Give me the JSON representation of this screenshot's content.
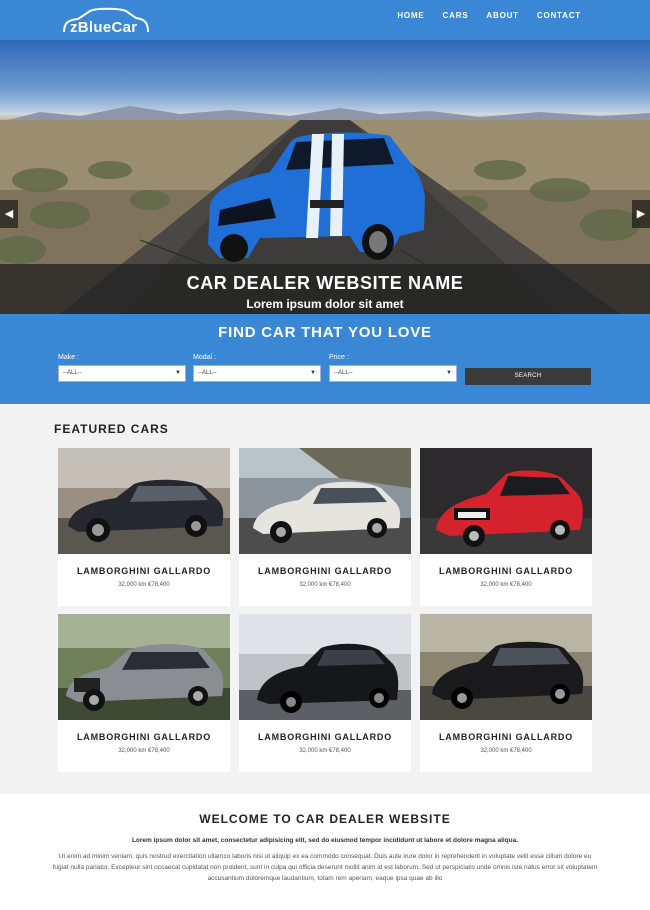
{
  "brand": {
    "name": "zBlueCar"
  },
  "nav": {
    "items": [
      "HOME",
      "CARS",
      "ABOUT",
      "CONTACT"
    ]
  },
  "hero": {
    "title": "CAR DEALER WEBSITE NAME",
    "subtitle": "Lorem ipsum dolor sit amet",
    "prev_icon": "chevron-left-icon",
    "next_icon": "chevron-right-icon"
  },
  "search": {
    "title": "FIND CAR THAT YOU LOVE",
    "fields": [
      {
        "label": "Make :",
        "value": "--ALL--"
      },
      {
        "label": "Modal :",
        "value": "--ALL--"
      },
      {
        "label": "Price :",
        "value": "--ALL--"
      }
    ],
    "button": "SEARCH"
  },
  "featured": {
    "title": "FEATURED CARS",
    "cars": [
      {
        "name": "LAMBORGHINI GALLARDO",
        "meta": "32,000 km €78,400"
      },
      {
        "name": "LAMBORGHINI GALLARDO",
        "meta": "32,000 km €78,400"
      },
      {
        "name": "LAMBORGHINI GALLARDO",
        "meta": "32,000 km €78,400"
      },
      {
        "name": "LAMBORGHINI GALLARDO",
        "meta": "32,000 km €78,400"
      },
      {
        "name": "LAMBORGHINI GALLARDO",
        "meta": "32,000 km €78,400"
      },
      {
        "name": "LAMBORGHINI GALLARDO",
        "meta": "32,000 km €78,400"
      }
    ]
  },
  "welcome": {
    "title": "WELCOME TO CAR DEALER WEBSITE",
    "lead": "Lorem ipsum dolor sit amet, consectetur adipisicing elit, sed do eiusmod tempor incididunt ut labore et dolore magna aliqua.",
    "body": "Ut enim ad minim veniam, quis nostrud exercitation ullamco laboris nisi ut aliquip ex ea commodo consequat. Duis aute irure dolor in reprehenderit in voluptate velit esse cillum dolore eu fugiat nulla pariatur. Excepteur sint occaecat cupidatat non proident, sunt in culpa qui officia deserunt mollit anim id est laborum. Sed ut perspiciatis unde omnis iste natus error sit voluptatem accusantium doloremque laudantium, totam rem aperiam, eaque ipsa quae ab illo"
  },
  "colors": {
    "accent": "#3a87d6",
    "dark": "#3b3b3b"
  }
}
